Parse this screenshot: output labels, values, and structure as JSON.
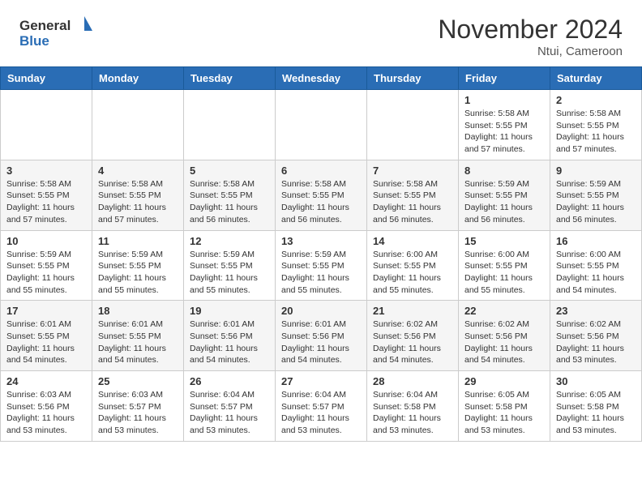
{
  "header": {
    "logo_general": "General",
    "logo_blue": "Blue",
    "month": "November 2024",
    "location": "Ntui, Cameroon"
  },
  "days_of_week": [
    "Sunday",
    "Monday",
    "Tuesday",
    "Wednesday",
    "Thursday",
    "Friday",
    "Saturday"
  ],
  "weeks": [
    [
      {
        "day": "",
        "info": ""
      },
      {
        "day": "",
        "info": ""
      },
      {
        "day": "",
        "info": ""
      },
      {
        "day": "",
        "info": ""
      },
      {
        "day": "",
        "info": ""
      },
      {
        "day": "1",
        "info": "Sunrise: 5:58 AM\nSunset: 5:55 PM\nDaylight: 11 hours\nand 57 minutes."
      },
      {
        "day": "2",
        "info": "Sunrise: 5:58 AM\nSunset: 5:55 PM\nDaylight: 11 hours\nand 57 minutes."
      }
    ],
    [
      {
        "day": "3",
        "info": "Sunrise: 5:58 AM\nSunset: 5:55 PM\nDaylight: 11 hours\nand 57 minutes."
      },
      {
        "day": "4",
        "info": "Sunrise: 5:58 AM\nSunset: 5:55 PM\nDaylight: 11 hours\nand 57 minutes."
      },
      {
        "day": "5",
        "info": "Sunrise: 5:58 AM\nSunset: 5:55 PM\nDaylight: 11 hours\nand 56 minutes."
      },
      {
        "day": "6",
        "info": "Sunrise: 5:58 AM\nSunset: 5:55 PM\nDaylight: 11 hours\nand 56 minutes."
      },
      {
        "day": "7",
        "info": "Sunrise: 5:58 AM\nSunset: 5:55 PM\nDaylight: 11 hours\nand 56 minutes."
      },
      {
        "day": "8",
        "info": "Sunrise: 5:59 AM\nSunset: 5:55 PM\nDaylight: 11 hours\nand 56 minutes."
      },
      {
        "day": "9",
        "info": "Sunrise: 5:59 AM\nSunset: 5:55 PM\nDaylight: 11 hours\nand 56 minutes."
      }
    ],
    [
      {
        "day": "10",
        "info": "Sunrise: 5:59 AM\nSunset: 5:55 PM\nDaylight: 11 hours\nand 55 minutes."
      },
      {
        "day": "11",
        "info": "Sunrise: 5:59 AM\nSunset: 5:55 PM\nDaylight: 11 hours\nand 55 minutes."
      },
      {
        "day": "12",
        "info": "Sunrise: 5:59 AM\nSunset: 5:55 PM\nDaylight: 11 hours\nand 55 minutes."
      },
      {
        "day": "13",
        "info": "Sunrise: 5:59 AM\nSunset: 5:55 PM\nDaylight: 11 hours\nand 55 minutes."
      },
      {
        "day": "14",
        "info": "Sunrise: 6:00 AM\nSunset: 5:55 PM\nDaylight: 11 hours\nand 55 minutes."
      },
      {
        "day": "15",
        "info": "Sunrise: 6:00 AM\nSunset: 5:55 PM\nDaylight: 11 hours\nand 55 minutes."
      },
      {
        "day": "16",
        "info": "Sunrise: 6:00 AM\nSunset: 5:55 PM\nDaylight: 11 hours\nand 54 minutes."
      }
    ],
    [
      {
        "day": "17",
        "info": "Sunrise: 6:01 AM\nSunset: 5:55 PM\nDaylight: 11 hours\nand 54 minutes."
      },
      {
        "day": "18",
        "info": "Sunrise: 6:01 AM\nSunset: 5:55 PM\nDaylight: 11 hours\nand 54 minutes."
      },
      {
        "day": "19",
        "info": "Sunrise: 6:01 AM\nSunset: 5:56 PM\nDaylight: 11 hours\nand 54 minutes."
      },
      {
        "day": "20",
        "info": "Sunrise: 6:01 AM\nSunset: 5:56 PM\nDaylight: 11 hours\nand 54 minutes."
      },
      {
        "day": "21",
        "info": "Sunrise: 6:02 AM\nSunset: 5:56 PM\nDaylight: 11 hours\nand 54 minutes."
      },
      {
        "day": "22",
        "info": "Sunrise: 6:02 AM\nSunset: 5:56 PM\nDaylight: 11 hours\nand 54 minutes."
      },
      {
        "day": "23",
        "info": "Sunrise: 6:02 AM\nSunset: 5:56 PM\nDaylight: 11 hours\nand 53 minutes."
      }
    ],
    [
      {
        "day": "24",
        "info": "Sunrise: 6:03 AM\nSunset: 5:56 PM\nDaylight: 11 hours\nand 53 minutes."
      },
      {
        "day": "25",
        "info": "Sunrise: 6:03 AM\nSunset: 5:57 PM\nDaylight: 11 hours\nand 53 minutes."
      },
      {
        "day": "26",
        "info": "Sunrise: 6:04 AM\nSunset: 5:57 PM\nDaylight: 11 hours\nand 53 minutes."
      },
      {
        "day": "27",
        "info": "Sunrise: 6:04 AM\nSunset: 5:57 PM\nDaylight: 11 hours\nand 53 minutes."
      },
      {
        "day": "28",
        "info": "Sunrise: 6:04 AM\nSunset: 5:58 PM\nDaylight: 11 hours\nand 53 minutes."
      },
      {
        "day": "29",
        "info": "Sunrise: 6:05 AM\nSunset: 5:58 PM\nDaylight: 11 hours\nand 53 minutes."
      },
      {
        "day": "30",
        "info": "Sunrise: 6:05 AM\nSunset: 5:58 PM\nDaylight: 11 hours\nand 53 minutes."
      }
    ]
  ]
}
